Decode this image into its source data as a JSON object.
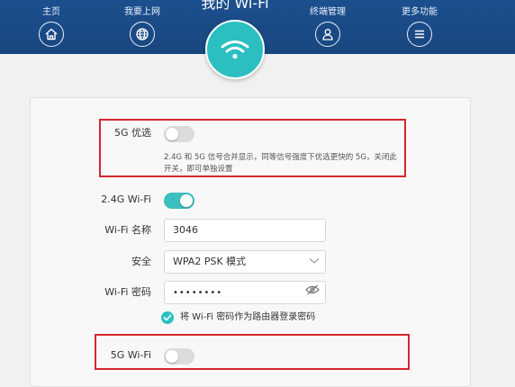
{
  "nav": {
    "items": [
      {
        "label": "主页",
        "icon": "home-icon"
      },
      {
        "label": "我要上网",
        "icon": "globe-icon"
      },
      {
        "label": "终端管理",
        "icon": "user-icon"
      },
      {
        "label": "更多功能",
        "icon": "menu-icon"
      }
    ],
    "active": {
      "label": "我的 Wi-Fi",
      "icon": "wifi-icon"
    }
  },
  "settings": {
    "pref_5g": {
      "label": "5G 优选",
      "enabled": false,
      "description": "2.4G 和 5G 信号合并显示，同等信号强度下优选更快的 5G，关闭此开关，即可单独设置"
    },
    "wifi_24g": {
      "toggle_label": "2.4G Wi-Fi",
      "enabled": true,
      "name_label": "Wi-Fi 名称",
      "name_value": "3046",
      "security_label": "安全",
      "security_value": "WPA2 PSK 模式",
      "password_label": "Wi-Fi 密码",
      "password_value": "••••••••",
      "use_as_admin_label": "将 Wi-Fi 密码作为路由器登录密码",
      "use_as_admin_checked": true
    },
    "wifi_5g": {
      "toggle_label": "5G Wi-Fi",
      "enabled": false
    }
  },
  "colors": {
    "header": "#1c4f8e",
    "accent": "#2cbfc2",
    "highlight_border": "#d7262c"
  }
}
